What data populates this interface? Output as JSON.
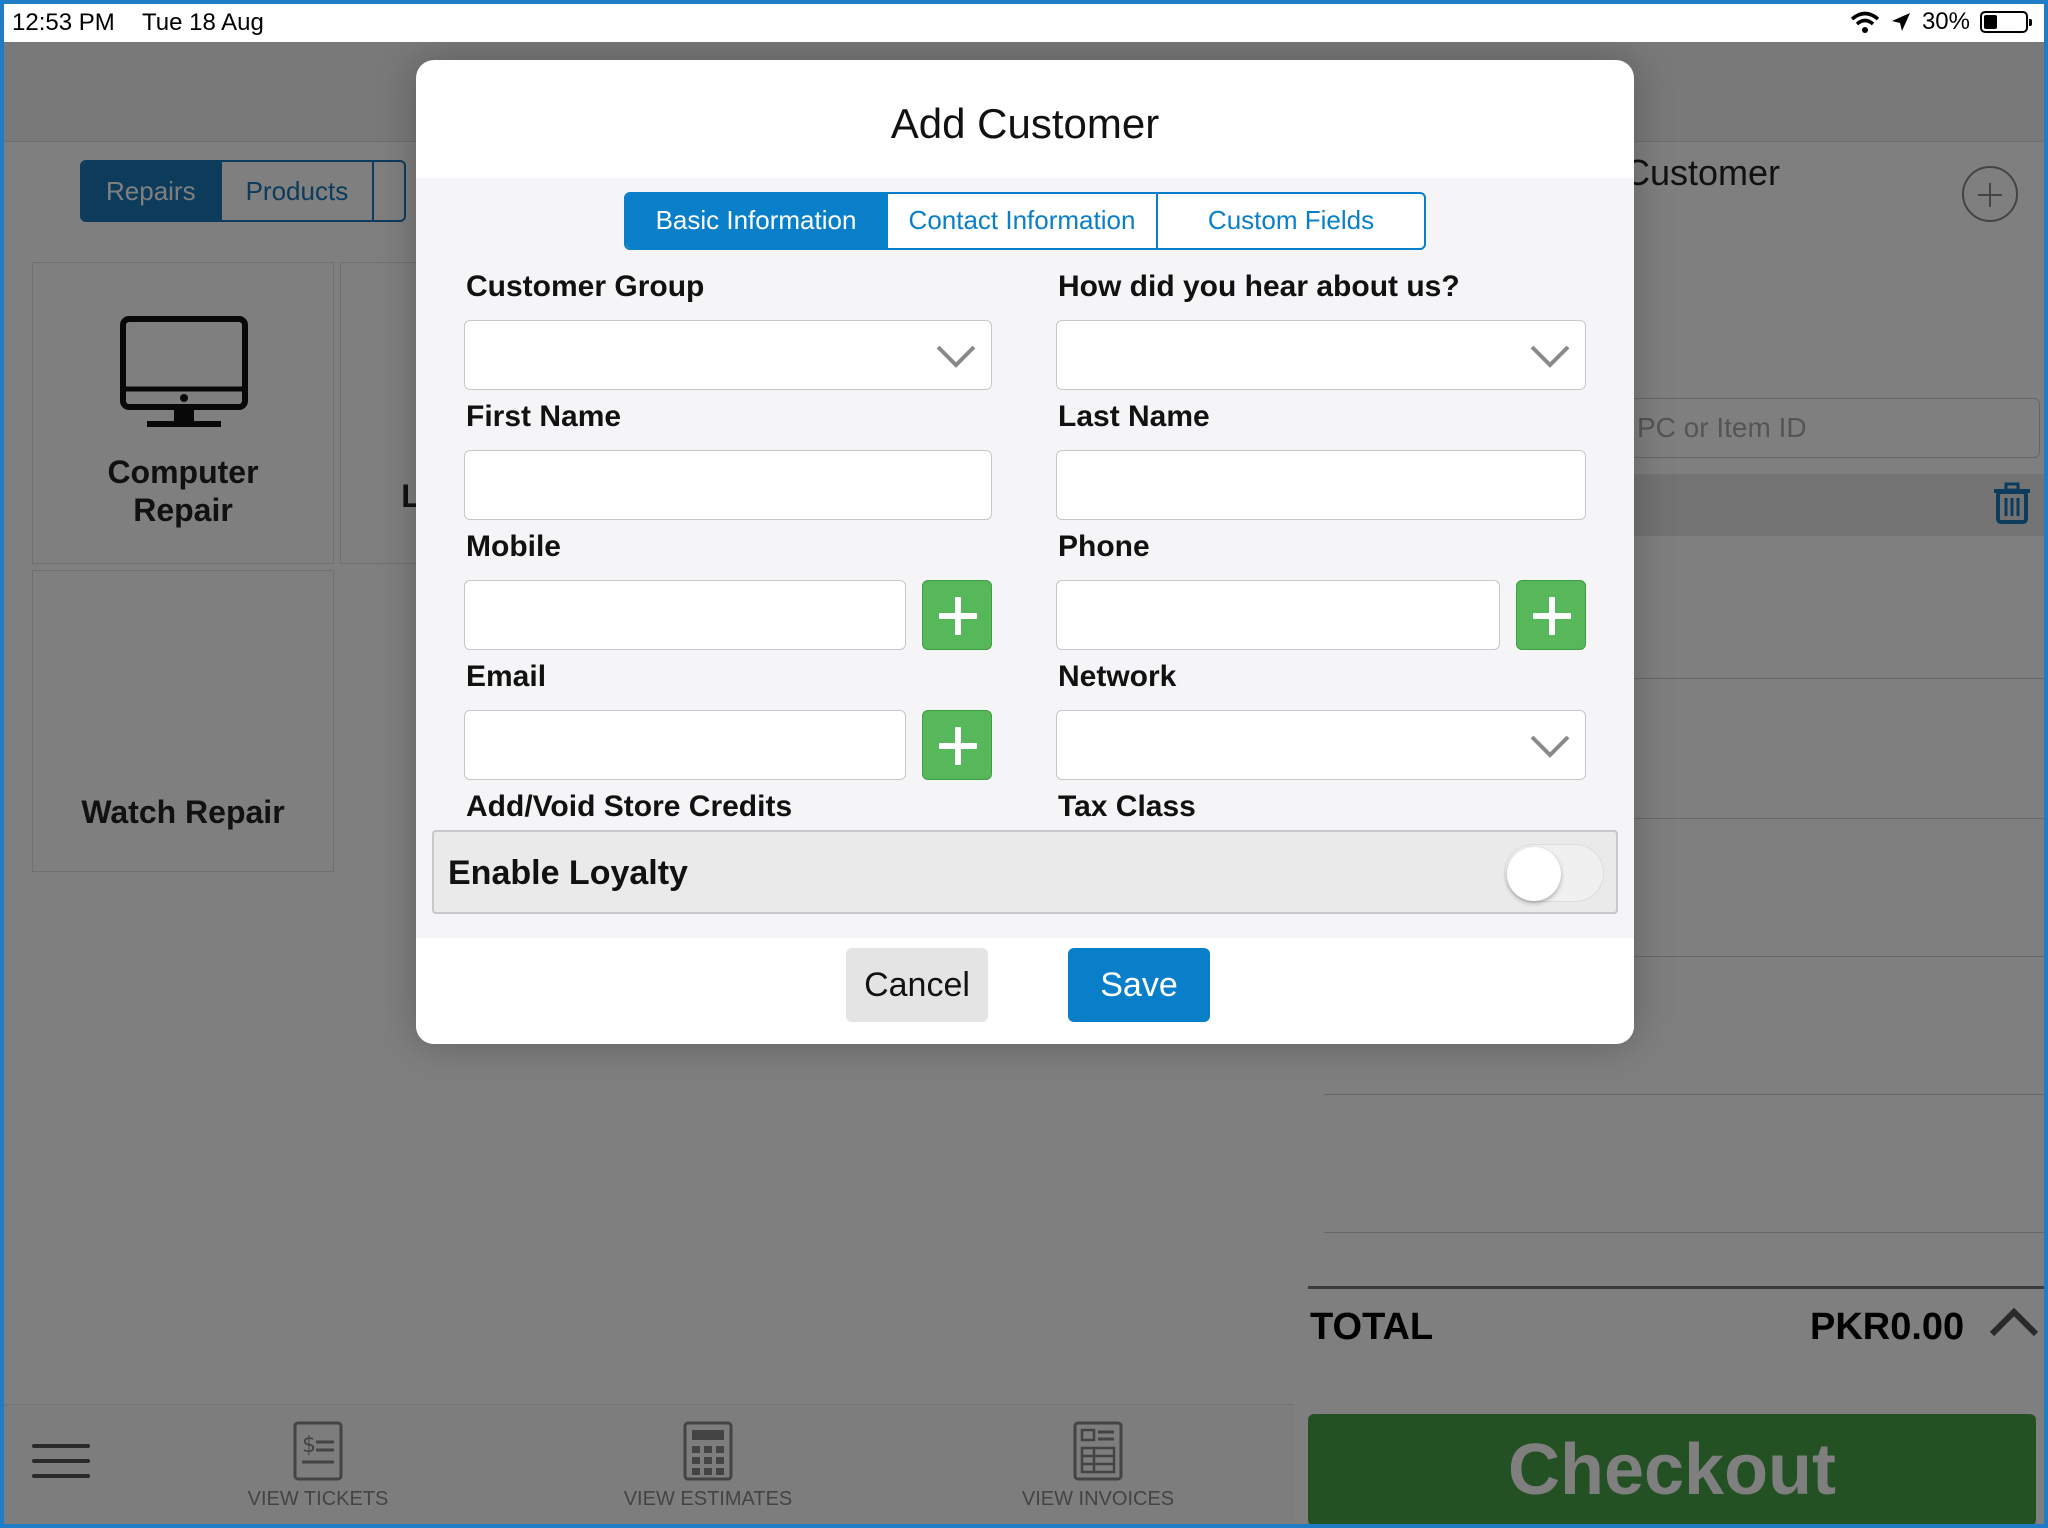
{
  "status_bar": {
    "time": "12:53 PM",
    "date": "Tue 18 Aug",
    "battery": "30%"
  },
  "background": {
    "tabs": [
      "Repairs",
      "Products"
    ],
    "tiles": {
      "computer_repair_line1": "Computer",
      "computer_repair_line2": "Repair",
      "watch_repair": "Watch Repair",
      "partial_tile_char": "L"
    },
    "right_panel": {
      "title": "Customer",
      "search_placeholder": "PC or Item ID",
      "total_label": "TOTAL",
      "total_value": "PKR0.00",
      "checkout": "Checkout"
    },
    "bottom_nav": [
      "VIEW TICKETS",
      "VIEW ESTIMATES",
      "VIEW INVOICES"
    ]
  },
  "modal": {
    "title": "Add Customer",
    "tabs": [
      "Basic Information",
      "Contact Information",
      "Custom Fields"
    ],
    "fields": {
      "customer_group": "Customer Group",
      "how_heard": "How did you hear about us?",
      "first_name": "First Name",
      "last_name": "Last Name",
      "mobile": "Mobile",
      "phone": "Phone",
      "email": "Email",
      "network": "Network",
      "store_credits": "Add/Void Store Credits",
      "tax_class": "Tax Class"
    },
    "loyalty_label": "Enable Loyalty",
    "loyalty_enabled": false,
    "cancel": "Cancel",
    "save": "Save"
  },
  "colors": {
    "accent_blue": "#0a7fc9",
    "add_green": "#56b85a",
    "checkout_green": "#47a347"
  }
}
